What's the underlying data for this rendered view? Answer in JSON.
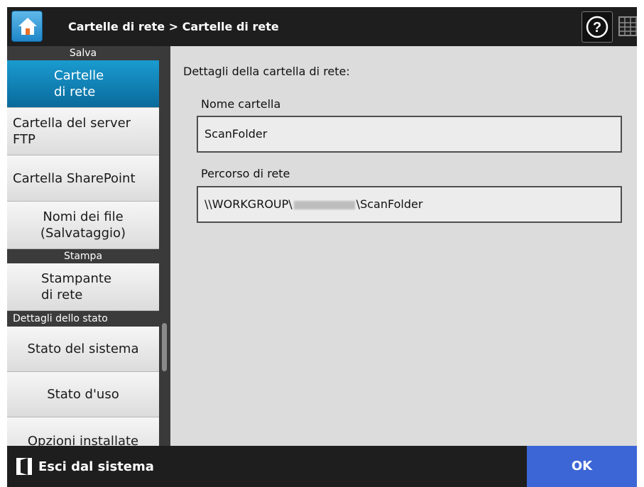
{
  "header": {
    "breadcrumb": "Cartelle di rete > Cartelle di rete",
    "icons": {
      "home": "home-icon",
      "help": "help-icon",
      "keyboard": "keyboard-icon"
    }
  },
  "sidebar": {
    "sections": {
      "salva": "Salva",
      "stampa": "Stampa",
      "stato": "Dettagli dello stato"
    },
    "items": [
      {
        "line1": "Cartelle",
        "line2": "di rete",
        "active": true
      },
      {
        "line1": "Cartella del server",
        "line2": "FTP"
      },
      {
        "line1": "Cartella SharePoint"
      },
      {
        "line1": "Nomi dei file",
        "line2": "(Salvataggio)"
      },
      {
        "line1": "Stampante",
        "line2": "di rete"
      },
      {
        "line1": "Stato del sistema"
      },
      {
        "line1": "Stato d'uso"
      },
      {
        "line1": "Opzioni installate"
      }
    ]
  },
  "main": {
    "title": "Dettagli della cartella di rete:",
    "folder_name_label": "Nome cartella",
    "folder_name_value": "ScanFolder",
    "path_label": "Percorso di rete",
    "path_prefix": "\\\\WORKGROUP\\",
    "path_suffix": "\\ScanFolder"
  },
  "footer": {
    "logout_label": "Esci dal sistema",
    "ok_label": "OK"
  },
  "colors": {
    "accent": "#1a9bd0",
    "ok_button": "#3c66d6",
    "header_bg": "#1e1e1e"
  }
}
